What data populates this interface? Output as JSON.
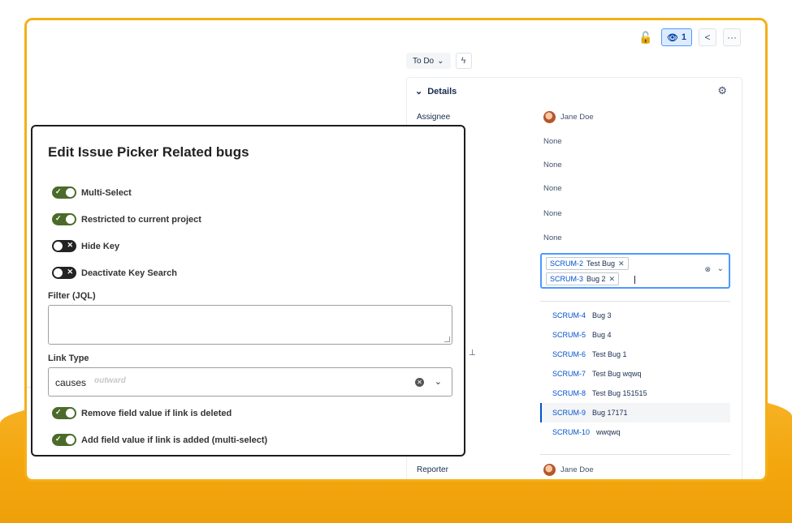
{
  "header": {
    "watch_count": "1",
    "lock_icon": "unlock-icon",
    "watch_icon": "eye-icon",
    "share_icon": "share-icon",
    "more_label": "···"
  },
  "status": {
    "label": "To Do",
    "chevron": "⌄",
    "bolt_icon": "lightning-icon"
  },
  "details": {
    "title": "Details",
    "fields": [
      {
        "label": "Assignee",
        "value": "Jane Doe"
      },
      {
        "label": "",
        "value": "None"
      },
      {
        "label": "",
        "value": "None"
      },
      {
        "label": "",
        "value": "None"
      },
      {
        "label": "",
        "value": "None"
      },
      {
        "label": "",
        "value": "None"
      }
    ],
    "reporter_label": "Reporter",
    "reporter_value": "Jane Doe"
  },
  "picker": {
    "selected": [
      {
        "key": "SCRUM-2",
        "summary": "Test Bug"
      },
      {
        "key": "SCRUM-3",
        "summary": "Bug 2"
      }
    ],
    "options": [
      {
        "key": "SCRUM-4",
        "summary": "Bug 3"
      },
      {
        "key": "SCRUM-5",
        "summary": "Bug 4"
      },
      {
        "key": "SCRUM-6",
        "summary": "Test Bug 1"
      },
      {
        "key": "SCRUM-7",
        "summary": "Test Bug wqwq"
      },
      {
        "key": "SCRUM-8",
        "summary": "Test Bug 151515"
      },
      {
        "key": "SCRUM-9",
        "summary": "Bug 17171"
      },
      {
        "key": "SCRUM-10",
        "summary": "wwqwq"
      }
    ]
  },
  "dialog": {
    "title": "Edit Issue Picker Related bugs",
    "toggles": [
      {
        "label": "Multi-Select",
        "on": true
      },
      {
        "label": "Restricted to current project",
        "on": true
      },
      {
        "label": "Hide Key",
        "on": false
      },
      {
        "label": "Deactivate Key Search",
        "on": false
      }
    ],
    "filter_label": "Filter (JQL)",
    "filter_value": "",
    "link_type_label": "Link Type",
    "link_type_value": "causes",
    "link_type_hint": "outward",
    "bottom_toggles": [
      {
        "label": "Remove field value if link is deleted",
        "on": true
      },
      {
        "label": "Add field value if link is added (multi-select)",
        "on": true
      }
    ]
  },
  "colors": {
    "accent_orange": "#f4b018",
    "toggle_on": "#4b6b2a",
    "toggle_off": "#222222",
    "link_blue": "#0052cc"
  }
}
